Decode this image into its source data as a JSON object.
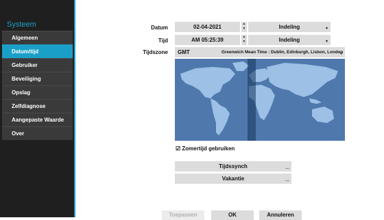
{
  "sidebar": {
    "title": "Systeem",
    "items": [
      {
        "label": "Algemeen"
      },
      {
        "label": "Datum/tijd"
      },
      {
        "label": "Gebruiker"
      },
      {
        "label": "Beveiliging"
      },
      {
        "label": "Opslag"
      },
      {
        "label": "Zelfdiagnose"
      },
      {
        "label": "Aangepaste Waarde"
      },
      {
        "label": "Over"
      }
    ],
    "active_index": 1
  },
  "form": {
    "date_label": "Datum",
    "date_value": "02-04-2021",
    "date_format": "Indeling",
    "time_label": "Tijd",
    "time_value": "AM 05:25:39",
    "time_format": "Indeling",
    "timezone_label": "Tijdszone",
    "timezone_code": "GMT",
    "timezone_name": "Greenwich Mean Time : Dublin, Edinburgh, Lisbon, London",
    "dst_label": "Zomertijd gebruiken",
    "dst_checked": true,
    "time_sync_label": "Tijdssynch",
    "holiday_label": "Vakantie"
  },
  "buttons": {
    "apply": "Toepassen",
    "ok": "OK",
    "cancel": "Annuleren"
  },
  "colors": {
    "accent": "#1aa0c8",
    "map_sea": "#4f78ad",
    "map_land": "#9cc0e6"
  }
}
